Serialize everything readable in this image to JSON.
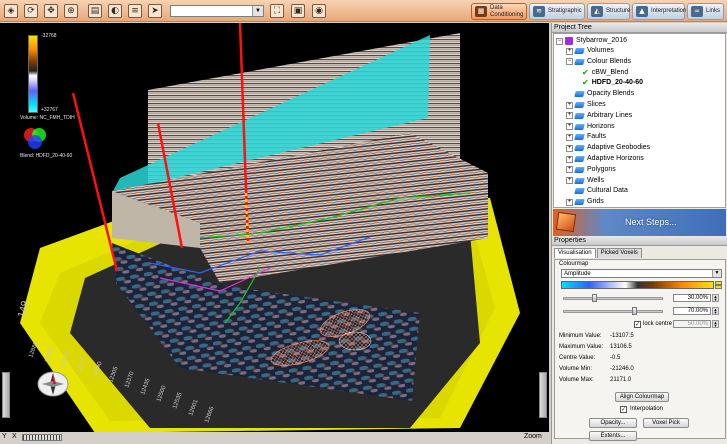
{
  "toolbar": {
    "icons": [
      "view-3d-icon",
      "rotate-icon",
      "pan-icon",
      "zoom-icon",
      "document-icon",
      "palette-icon",
      "layers-icon",
      "navigate-icon",
      "screenshot-icon",
      "save-icon",
      "camera-icon"
    ],
    "view_select_value": ""
  },
  "workflow": [
    {
      "label_line1": "Data",
      "label_line2": "Conditioning",
      "icon": "data-conditioning-icon",
      "active": true
    },
    {
      "label_line1": "Stratigraphic",
      "label_line2": "",
      "icon": "stratigraphic-icon",
      "active": false
    },
    {
      "label_line1": "Structure",
      "label_line2": "",
      "icon": "structure-icon",
      "active": false
    },
    {
      "label_line1": "Interpretation",
      "label_line2": "",
      "icon": "interpretation-icon",
      "active": false
    },
    {
      "label_line1": "Links",
      "label_line2": "",
      "icon": "links-icon",
      "active": false
    }
  ],
  "viewport": {
    "colorbar_max": "-32768",
    "colorbar_min": "+32767",
    "volume_label": "Volume: NC_FMH_TDIH",
    "blend_label": "Blend: HDFD_20-40-60",
    "axis_number_left": "149",
    "axis_ticks": [
      "12880",
      "12105",
      "12170",
      "12175",
      "12240",
      "12305",
      "12370",
      "12435",
      "12500",
      "12535",
      "12601",
      "12666"
    ]
  },
  "statusbar": {
    "y_label": "Y",
    "x_label": "X",
    "zoom_label": "Zoom"
  },
  "project_tree": {
    "title": "Project Tree",
    "root": "Stybarrow_2016",
    "items": [
      {
        "label": "Volumes",
        "level": 1,
        "expander": "+"
      },
      {
        "label": "Colour Blends",
        "level": 1,
        "expander": "-"
      },
      {
        "label": "cBW_Blend",
        "level": 2,
        "checked": true
      },
      {
        "label": "HDFD_20-40-60",
        "level": 2,
        "checked": true,
        "bold": true
      },
      {
        "label": "Opacity Blends",
        "level": 1,
        "expander": ""
      },
      {
        "label": "Slices",
        "level": 1,
        "expander": "+"
      },
      {
        "label": "Arbitrary Lines",
        "level": 1,
        "expander": "+"
      },
      {
        "label": "Horizons",
        "level": 1,
        "expander": "+"
      },
      {
        "label": "Faults",
        "level": 1,
        "expander": "+"
      },
      {
        "label": "Adaptive Geobodies",
        "level": 1,
        "expander": "+"
      },
      {
        "label": "Adaptive Horizons",
        "level": 1,
        "expander": "+"
      },
      {
        "label": "Polygons",
        "level": 1,
        "expander": "+"
      },
      {
        "label": "Wells",
        "level": 1,
        "expander": "+"
      },
      {
        "label": "Cultural Data",
        "level": 1,
        "expander": ""
      },
      {
        "label": "Grids",
        "level": 1,
        "expander": "+"
      }
    ]
  },
  "next_steps": {
    "label": "Next Steps..."
  },
  "properties": {
    "title": "Properties",
    "tabs": [
      "Visualisation",
      "Picked Voxels"
    ],
    "colourmap_label": "Colourmap",
    "colourmap_value": "Amplitude",
    "slider1_value": 0.3,
    "slider2_value": 0.7,
    "pct1": "30.00%",
    "pct2": "70.00%",
    "lock_centre_label": "lock centre at",
    "lock_centre_value": "50.00%",
    "stats": [
      {
        "label": "Minimum Value:",
        "value": "-13107.5"
      },
      {
        "label": "Maximum Value:",
        "value": "13106.5"
      },
      {
        "label": "Centre Value:",
        "value": "-0.5"
      },
      {
        "label": "Volume Min:",
        "value": "-21246.0"
      },
      {
        "label": "Volume Max:",
        "value": "21171.0"
      }
    ],
    "align_button": "Align Colourmap",
    "interpolation_label": "Interpolation",
    "opacity_button": "Opacity...",
    "voxel_pick_button": "Voxel Pick",
    "extents_button": "Extents..."
  },
  "colors": {
    "accent_orange": "#f09a62",
    "horizon_yellow": "#f2f000",
    "plane_cyan": "#28d8d8"
  }
}
